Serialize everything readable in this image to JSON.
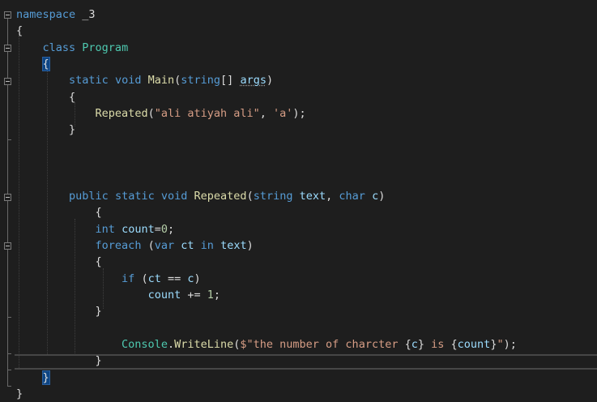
{
  "editor": {
    "language": "csharp",
    "theme_background": "#1e1e1e",
    "colors": {
      "keyword": "#569cd6",
      "type": "#4ec9b0",
      "method": "#dcdcaa",
      "string": "#d69d85",
      "number": "#b5cea8",
      "identifier": "#9cdcfe",
      "punctuation": "#dcdcdc"
    },
    "icons": [
      "fold-collapse-icon"
    ],
    "lines": [
      {
        "tokens": [
          {
            "t": "namespace",
            "k": "kw"
          },
          {
            "t": " _3",
            "k": "p"
          }
        ]
      },
      {
        "tokens": [
          {
            "t": "{",
            "k": "p"
          }
        ]
      },
      {
        "tokens": [
          {
            "t": "    ",
            "k": "p"
          },
          {
            "t": "class",
            "k": "kw"
          },
          {
            "t": " ",
            "k": "p"
          },
          {
            "t": "Program",
            "k": "cls"
          }
        ]
      },
      {
        "tokens": [
          {
            "t": "    ",
            "k": "p"
          },
          {
            "t": "{",
            "k": "p",
            "hl": true
          }
        ]
      },
      {
        "tokens": [
          {
            "t": "        ",
            "k": "p"
          },
          {
            "t": "static",
            "k": "kw"
          },
          {
            "t": " ",
            "k": "p"
          },
          {
            "t": "void",
            "k": "kw"
          },
          {
            "t": " ",
            "k": "p"
          },
          {
            "t": "Main",
            "k": "mth"
          },
          {
            "t": "(",
            "k": "p"
          },
          {
            "t": "string",
            "k": "kw"
          },
          {
            "t": "[] ",
            "k": "p"
          },
          {
            "t": "args",
            "k": "var",
            "sq": true
          },
          {
            "t": ")",
            "k": "p"
          }
        ]
      },
      {
        "tokens": [
          {
            "t": "        {",
            "k": "p"
          }
        ]
      },
      {
        "tokens": [
          {
            "t": "            ",
            "k": "p"
          },
          {
            "t": "Repeated",
            "k": "mth"
          },
          {
            "t": "(",
            "k": "p"
          },
          {
            "t": "\"ali atiyah ali\"",
            "k": "str"
          },
          {
            "t": ", ",
            "k": "p"
          },
          {
            "t": "'a'",
            "k": "str"
          },
          {
            "t": ");",
            "k": "p"
          }
        ]
      },
      {
        "tokens": [
          {
            "t": "        }",
            "k": "p"
          }
        ]
      },
      {
        "tokens": []
      },
      {
        "tokens": []
      },
      {
        "tokens": []
      },
      {
        "tokens": [
          {
            "t": "        ",
            "k": "p"
          },
          {
            "t": "public",
            "k": "kw"
          },
          {
            "t": " ",
            "k": "p"
          },
          {
            "t": "static",
            "k": "kw"
          },
          {
            "t": " ",
            "k": "p"
          },
          {
            "t": "void",
            "k": "kw"
          },
          {
            "t": " ",
            "k": "p"
          },
          {
            "t": "Repeated",
            "k": "mth"
          },
          {
            "t": "(",
            "k": "p"
          },
          {
            "t": "string",
            "k": "kw"
          },
          {
            "t": " ",
            "k": "p"
          },
          {
            "t": "text",
            "k": "var"
          },
          {
            "t": ", ",
            "k": "p"
          },
          {
            "t": "char",
            "k": "kw"
          },
          {
            "t": " ",
            "k": "p"
          },
          {
            "t": "c",
            "k": "var"
          },
          {
            "t": ")",
            "k": "p"
          }
        ]
      },
      {
        "tokens": [
          {
            "t": "            {",
            "k": "p"
          }
        ]
      },
      {
        "tokens": [
          {
            "t": "            ",
            "k": "p"
          },
          {
            "t": "int",
            "k": "kw"
          },
          {
            "t": " ",
            "k": "p"
          },
          {
            "t": "count",
            "k": "var"
          },
          {
            "t": "=",
            "k": "p"
          },
          {
            "t": "0",
            "k": "num"
          },
          {
            "t": ";",
            "k": "p"
          }
        ]
      },
      {
        "tokens": [
          {
            "t": "            ",
            "k": "p"
          },
          {
            "t": "foreach",
            "k": "kw"
          },
          {
            "t": " (",
            "k": "p"
          },
          {
            "t": "var",
            "k": "kw"
          },
          {
            "t": " ",
            "k": "p"
          },
          {
            "t": "ct",
            "k": "var"
          },
          {
            "t": " ",
            "k": "p"
          },
          {
            "t": "in",
            "k": "kw"
          },
          {
            "t": " ",
            "k": "p"
          },
          {
            "t": "text",
            "k": "var"
          },
          {
            "t": ")",
            "k": "p"
          }
        ]
      },
      {
        "tokens": [
          {
            "t": "            {",
            "k": "p"
          }
        ]
      },
      {
        "tokens": [
          {
            "t": "                ",
            "k": "p"
          },
          {
            "t": "if",
            "k": "kw"
          },
          {
            "t": " (",
            "k": "p"
          },
          {
            "t": "ct",
            "k": "var"
          },
          {
            "t": " == ",
            "k": "p"
          },
          {
            "t": "c",
            "k": "var"
          },
          {
            "t": ")",
            "k": "p"
          }
        ]
      },
      {
        "tokens": [
          {
            "t": "                    ",
            "k": "p"
          },
          {
            "t": "count",
            "k": "var"
          },
          {
            "t": " += ",
            "k": "p"
          },
          {
            "t": "1",
            "k": "num"
          },
          {
            "t": ";",
            "k": "p"
          }
        ]
      },
      {
        "tokens": [
          {
            "t": "            }",
            "k": "p"
          }
        ]
      },
      {
        "tokens": []
      },
      {
        "tokens": [
          {
            "t": "                ",
            "k": "p"
          },
          {
            "t": "Console",
            "k": "cls"
          },
          {
            "t": ".",
            "k": "p"
          },
          {
            "t": "WriteLine",
            "k": "mth"
          },
          {
            "t": "(",
            "k": "p"
          },
          {
            "t": "$\"the number of charcter ",
            "k": "str"
          },
          {
            "t": "{",
            "k": "p"
          },
          {
            "t": "c",
            "k": "var"
          },
          {
            "t": "}",
            "k": "p"
          },
          {
            "t": " is ",
            "k": "str"
          },
          {
            "t": "{",
            "k": "p"
          },
          {
            "t": "count",
            "k": "var"
          },
          {
            "t": "}",
            "k": "p"
          },
          {
            "t": "\"",
            "k": "str"
          },
          {
            "t": ");",
            "k": "p"
          }
        ]
      },
      {
        "tokens": [
          {
            "t": "            }",
            "k": "p"
          }
        ]
      },
      {
        "tokens": [
          {
            "t": "    ",
            "k": "p"
          },
          {
            "t": "}",
            "k": "p",
            "hl": true
          }
        ]
      },
      {
        "tokens": [
          {
            "t": "}",
            "k": "p"
          }
        ]
      }
    ]
  }
}
